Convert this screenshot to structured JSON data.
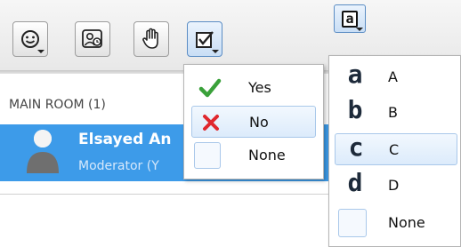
{
  "toolbar": {
    "buttons": [
      {
        "icon": "smiley-icon"
      },
      {
        "icon": "user-clock-icon"
      },
      {
        "icon": "raise-hand-icon"
      },
      {
        "icon": "checkbox-poll-icon"
      }
    ],
    "letter_button": {
      "icon": "letter-poll-icon",
      "glyph": "a"
    }
  },
  "room": {
    "title": "MAIN ROOM (1)",
    "user": {
      "name": "Elsayed An",
      "role": "Moderator (Y"
    }
  },
  "yesno_menu": {
    "items": [
      {
        "label": "Yes",
        "icon": "checkmark-icon",
        "color": "#3aa13a"
      },
      {
        "label": "No",
        "icon": "cross-icon",
        "color": "#e0282e",
        "selected": true
      },
      {
        "label": "None",
        "icon": "empty-box-icon"
      }
    ]
  },
  "letter_menu": {
    "items": [
      {
        "glyph": "a",
        "label": "A"
      },
      {
        "glyph": "b",
        "label": "B"
      },
      {
        "glyph": "c",
        "label": "C",
        "selected": true
      },
      {
        "glyph": "d",
        "label": "D"
      },
      {
        "glyph": "",
        "label": "None"
      }
    ]
  },
  "colors": {
    "selection_blue": "#3d9be9",
    "menu_highlight": "#dcebfb"
  }
}
